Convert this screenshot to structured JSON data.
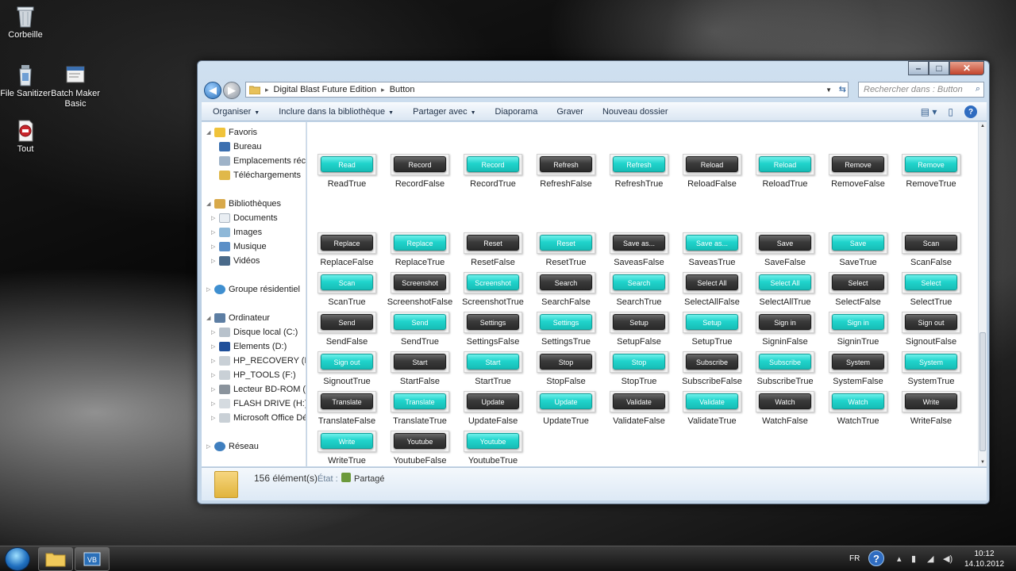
{
  "desktop": {
    "icons": [
      {
        "label": "Corbeille",
        "icon": "recycle-bin-icon"
      },
      {
        "label": "File Sanitizer",
        "icon": "file-sanitizer-icon"
      },
      {
        "label": "Batch Maker Basic",
        "icon": "batch-maker-icon"
      },
      {
        "label": "Tout",
        "icon": "stop-document-icon"
      }
    ]
  },
  "window": {
    "controls": {
      "minimize": "–",
      "maximize": "□",
      "close": "✕"
    },
    "address": {
      "segments": [
        "Digital Blast Future Edition",
        "Button"
      ],
      "separator": "▸"
    },
    "search": {
      "placeholder": "Rechercher dans : Button"
    },
    "toolbar": {
      "organize": "Organiser",
      "include": "Inclure dans la bibliothèque",
      "share": "Partager avec",
      "slideshow": "Diaporama",
      "burn": "Graver",
      "new_folder": "Nouveau dossier"
    },
    "nav": {
      "favorites": "Favoris",
      "desktop": "Bureau",
      "recent": "Emplacements récents",
      "downloads": "Téléchargements",
      "libraries": "Bibliothèques",
      "documents": "Documents",
      "images": "Images",
      "music": "Musique",
      "videos": "Vidéos",
      "homegroup": "Groupe résidentiel",
      "computer": "Ordinateur",
      "drives": [
        "Disque local (C:)",
        "Elements (D:)",
        "HP_RECOVERY (E:)",
        "HP_TOOLS (F:)",
        "Lecteur BD-ROM (G:)",
        "FLASH DRIVE (H:)",
        "Microsoft Office Démarrer"
      ],
      "network": "Réseau"
    },
    "files": [
      {
        "btn": "Read",
        "name": "ReadTrue",
        "style": "cyan"
      },
      {
        "btn": "Record",
        "name": "RecordFalse",
        "style": "dark"
      },
      {
        "btn": "Record",
        "name": "RecordTrue",
        "style": "cyan"
      },
      {
        "btn": "Refresh",
        "name": "RefreshFalse",
        "style": "dark"
      },
      {
        "btn": "Refresh",
        "name": "RefreshTrue",
        "style": "cyan"
      },
      {
        "btn": "Reload",
        "name": "ReloadFalse",
        "style": "dark"
      },
      {
        "btn": "Reload",
        "name": "ReloadTrue",
        "style": "cyan"
      },
      {
        "btn": "Remove",
        "name": "RemoveFalse",
        "style": "dark"
      },
      {
        "btn": "Remove",
        "name": "RemoveTrue",
        "style": "cyan"
      },
      {
        "btn": "Replace",
        "name": "ReplaceFalse",
        "style": "dark"
      },
      {
        "btn": "Replace",
        "name": "ReplaceTrue",
        "style": "cyan"
      },
      {
        "btn": "Reset",
        "name": "ResetFalse",
        "style": "dark"
      },
      {
        "btn": "Reset",
        "name": "ResetTrue",
        "style": "cyan"
      },
      {
        "btn": "Save as...",
        "name": "SaveasFalse",
        "style": "dark"
      },
      {
        "btn": "Save as...",
        "name": "SaveasTrue",
        "style": "cyan"
      },
      {
        "btn": "Save",
        "name": "SaveFalse",
        "style": "dark"
      },
      {
        "btn": "Save",
        "name": "SaveTrue",
        "style": "cyan"
      },
      {
        "btn": "Scan",
        "name": "ScanFalse",
        "style": "dark"
      },
      {
        "btn": "Scan",
        "name": "ScanTrue",
        "style": "cyan"
      },
      {
        "btn": "Screenshot",
        "name": "ScreenshotFalse",
        "style": "dark"
      },
      {
        "btn": "Screenshot",
        "name": "ScreenshotTrue",
        "style": "cyan"
      },
      {
        "btn": "Search",
        "name": "SearchFalse",
        "style": "dark"
      },
      {
        "btn": "Search",
        "name": "SearchTrue",
        "style": "cyan"
      },
      {
        "btn": "Select All",
        "name": "SelectAllFalse",
        "style": "dark"
      },
      {
        "btn": "Select All",
        "name": "SelectAllTrue",
        "style": "cyan"
      },
      {
        "btn": "Select",
        "name": "SelectFalse",
        "style": "dark"
      },
      {
        "btn": "Select",
        "name": "SelectTrue",
        "style": "cyan"
      },
      {
        "btn": "Send",
        "name": "SendFalse",
        "style": "dark"
      },
      {
        "btn": "Send",
        "name": "SendTrue",
        "style": "cyan"
      },
      {
        "btn": "Settings",
        "name": "SettingsFalse",
        "style": "dark"
      },
      {
        "btn": "Settings",
        "name": "SettingsTrue",
        "style": "cyan"
      },
      {
        "btn": "Setup",
        "name": "SetupFalse",
        "style": "dark"
      },
      {
        "btn": "Setup",
        "name": "SetupTrue",
        "style": "cyan"
      },
      {
        "btn": "Sign in",
        "name": "SigninFalse",
        "style": "dark"
      },
      {
        "btn": "Sign in",
        "name": "SigninTrue",
        "style": "cyan"
      },
      {
        "btn": "Sign out",
        "name": "SignoutFalse",
        "style": "dark"
      },
      {
        "btn": "Sign out",
        "name": "SignoutTrue",
        "style": "cyan"
      },
      {
        "btn": "Start",
        "name": "StartFalse",
        "style": "dark"
      },
      {
        "btn": "Start",
        "name": "StartTrue",
        "style": "cyan"
      },
      {
        "btn": "Stop",
        "name": "StopFalse",
        "style": "dark"
      },
      {
        "btn": "Stop",
        "name": "StopTrue",
        "style": "cyan"
      },
      {
        "btn": "Subscribe",
        "name": "SubscribeFalse",
        "style": "dark"
      },
      {
        "btn": "Subscribe",
        "name": "SubscribeTrue",
        "style": "cyan"
      },
      {
        "btn": "System",
        "name": "SystemFalse",
        "style": "dark"
      },
      {
        "btn": "System",
        "name": "SystemTrue",
        "style": "cyan"
      },
      {
        "btn": "Translate",
        "name": "TranslateFalse",
        "style": "dark"
      },
      {
        "btn": "Translate",
        "name": "TranslateTrue",
        "style": "cyan"
      },
      {
        "btn": "Update",
        "name": "UpdateFalse",
        "style": "dark"
      },
      {
        "btn": "Update",
        "name": "UpdateTrue",
        "style": "cyan"
      },
      {
        "btn": "Validate",
        "name": "ValidateFalse",
        "style": "dark"
      },
      {
        "btn": "Validate",
        "name": "ValidateTrue",
        "style": "cyan"
      },
      {
        "btn": "Watch",
        "name": "WatchFalse",
        "style": "dark"
      },
      {
        "btn": "Watch",
        "name": "WatchTrue",
        "style": "cyan"
      },
      {
        "btn": "Write",
        "name": "WriteFalse",
        "style": "dark"
      },
      {
        "btn": "Write",
        "name": "WriteTrue",
        "style": "cyan"
      },
      {
        "btn": "Youtube",
        "name": "YoutubeFalse",
        "style": "dark"
      },
      {
        "btn": "Youtube",
        "name": "YoutubeTrue",
        "style": "cyan"
      }
    ],
    "details": {
      "count": "156 élément(s)",
      "state_label": "État :",
      "state": "Partagé"
    }
  },
  "taskbar": {
    "language": "FR",
    "time": "10:12",
    "date": "14.10.2012",
    "help": "?"
  },
  "colors": {
    "cyan_button": "#20d4cc",
    "dark_button": "#3a3a3a",
    "window_chrome": "#c6d8ea",
    "taskbar": "#1a1a1a"
  }
}
